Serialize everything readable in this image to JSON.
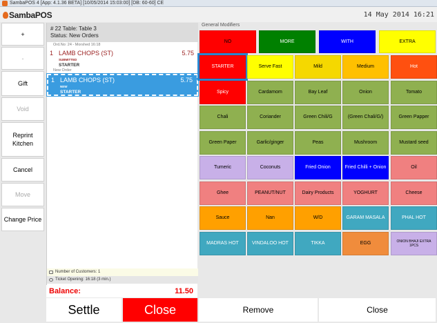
{
  "window": {
    "title": "SambaPOS 4 [App: 4.1.36 BETA] [10/05/2014 15:03:00] [DB: 60-60] CE"
  },
  "header": {
    "logo": "SambaPOS",
    "datetime": "14 May 2014 16:21"
  },
  "left_buttons": [
    {
      "label": "+",
      "enabled": true
    },
    {
      "label": "-",
      "enabled": false
    },
    {
      "label": "Gift",
      "enabled": true
    },
    {
      "label": "Void",
      "enabled": false
    },
    {
      "label": "Reprint Kitchen",
      "enabled": true
    },
    {
      "label": "Cancel",
      "enabled": true
    },
    {
      "label": "Move",
      "enabled": false
    },
    {
      "label": "Change Price",
      "enabled": true
    }
  ],
  "ticket": {
    "table": "# 22 Table: Table 3",
    "status": "Status: New Orders",
    "order_info": "Ord.No: 24 - Morshed  16:18",
    "new_order_label": "New Order",
    "lines": [
      {
        "qty": "1",
        "name": "LAMB CHOPS (ST)",
        "price": "5.75",
        "state": "SUBMITTED",
        "modifier": "STARTER"
      },
      {
        "qty": "1",
        "name": "LAMB CHOPS (ST)",
        "price": "5.75",
        "state": "NEW",
        "modifier": "STARTER"
      }
    ],
    "customers": "Number of Customers: 1",
    "opening": "Ticket Opening:  16:18 (3 min.)",
    "balance_label": "Balance:",
    "balance_value": "11.50"
  },
  "bottom_buttons": {
    "settle": "Settle",
    "close_red": "Close",
    "remove": "Remove",
    "close": "Close"
  },
  "modifiers": {
    "title": "General Modifiers",
    "top_row": [
      {
        "label": "NO",
        "color": "#ff0000",
        "text": "#000000"
      },
      {
        "label": "MORE",
        "color": "#008000",
        "text": "#ffffff"
      },
      {
        "label": "WITH",
        "color": "#0000ff",
        "text": "#ffffff"
      },
      {
        "label": "EXTRA",
        "color": "#ffff00",
        "text": "#000000"
      }
    ],
    "grid": [
      {
        "label": "STARTER",
        "color": "#ff0000",
        "text": "#ffffff",
        "selected": true
      },
      {
        "label": "Serve Fast",
        "color": "#ffff00",
        "text": "#000000"
      },
      {
        "label": "Mild",
        "color": "#f5d800",
        "text": "#000000"
      },
      {
        "label": "Medium",
        "color": "#ffc000",
        "text": "#000000"
      },
      {
        "label": "Hot",
        "color": "#ff5010",
        "text": "#ffffff"
      },
      {
        "label": "Spicy",
        "color": "#ff0000",
        "text": "#ffffff"
      },
      {
        "label": "Cardamom",
        "color": "#8fb050",
        "text": "#000000"
      },
      {
        "label": "Bay Leaf",
        "color": "#8fb050",
        "text": "#000000"
      },
      {
        "label": "Onion",
        "color": "#8fb050",
        "text": "#000000"
      },
      {
        "label": "Tomato",
        "color": "#8fb050",
        "text": "#000000"
      },
      {
        "label": "Chali",
        "color": "#8fb050",
        "text": "#000000"
      },
      {
        "label": "Coriander",
        "color": "#8fb050",
        "text": "#000000"
      },
      {
        "label": "Green Chili/G",
        "color": "#8fb050",
        "text": "#000000"
      },
      {
        "label": "(Green Chali/G/)",
        "color": "#8fb050",
        "text": "#000000"
      },
      {
        "label": "Green Papper",
        "color": "#8fb050",
        "text": "#000000"
      },
      {
        "label": "Green Paper",
        "color": "#8fb050",
        "text": "#000000"
      },
      {
        "label": "Garlic/ginger",
        "color": "#8fb050",
        "text": "#000000"
      },
      {
        "label": "Peas",
        "color": "#8fb050",
        "text": "#000000"
      },
      {
        "label": "Mushroom",
        "color": "#8fb050",
        "text": "#000000"
      },
      {
        "label": "Mustard seed",
        "color": "#8fb050",
        "text": "#000000"
      },
      {
        "label": "Tumeric",
        "color": "#c8b0e8",
        "text": "#000000"
      },
      {
        "label": "Coconuts",
        "color": "#c8b0e8",
        "text": "#000000"
      },
      {
        "label": "Fried Onion",
        "color": "#0000ff",
        "text": "#ffffff"
      },
      {
        "label": "Fried Chilli + Onion",
        "color": "#0000ff",
        "text": "#ffffff"
      },
      {
        "label": "Oil",
        "color": "#f08080",
        "text": "#000000"
      },
      {
        "label": "Ghee",
        "color": "#f08080",
        "text": "#000000"
      },
      {
        "label": "PEANUT/NUT",
        "color": "#f08080",
        "text": "#000000"
      },
      {
        "label": "Dairy Products",
        "color": "#f08080",
        "text": "#000000"
      },
      {
        "label": "YOGHURT",
        "color": "#f08080",
        "text": "#000000"
      },
      {
        "label": "Cheese",
        "color": "#f08080",
        "text": "#000000"
      },
      {
        "label": "Sauce",
        "color": "#ffa000",
        "text": "#000000"
      },
      {
        "label": "Nan",
        "color": "#ffa000",
        "text": "#000000"
      },
      {
        "label": "W/D",
        "color": "#ffa000",
        "text": "#000000"
      },
      {
        "label": "GARAM MASALA",
        "color": "#40a8c0",
        "text": "#ffffff"
      },
      {
        "label": "PHAL HOT",
        "color": "#40a8c0",
        "text": "#ffffff"
      },
      {
        "label": "MADRAS HOT",
        "color": "#40a8c0",
        "text": "#ffffff"
      },
      {
        "label": "VINDALOO HOT",
        "color": "#40a8c0",
        "text": "#ffffff"
      },
      {
        "label": "TIKKA",
        "color": "#40a8c0",
        "text": "#ffffff"
      },
      {
        "label": "EGG",
        "color": "#f08c3c",
        "text": "#000000"
      },
      {
        "label": "ONION BHAJI EXTRA 1PCS",
        "color": "#c8b0e8",
        "text": "#000000",
        "tiny": true
      }
    ]
  }
}
